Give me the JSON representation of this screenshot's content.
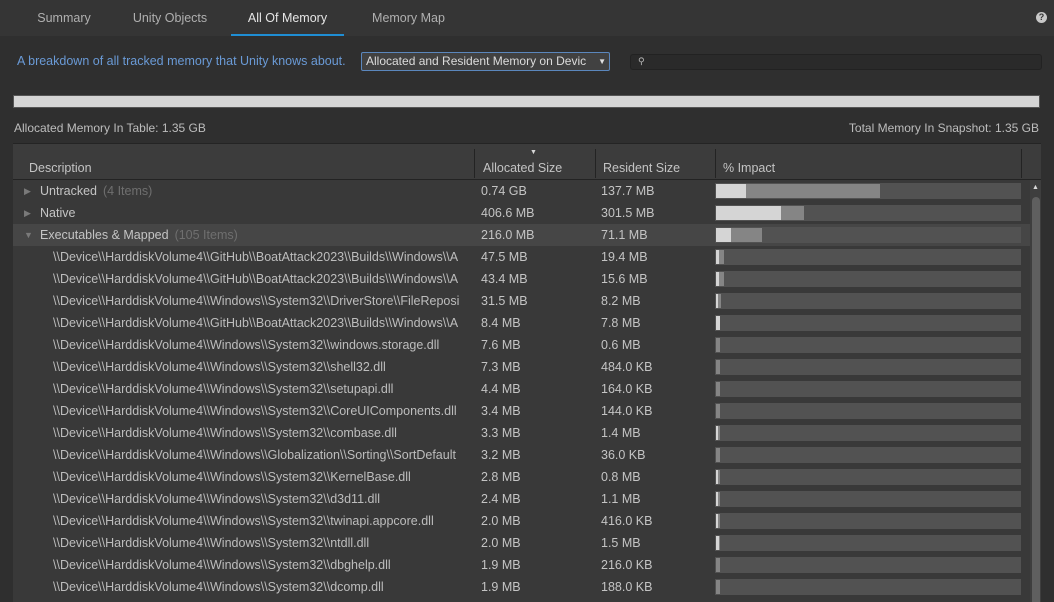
{
  "tabs": [
    {
      "label": "Summary",
      "active": false
    },
    {
      "label": "Unity Objects",
      "active": false
    },
    {
      "label": "All Of Memory",
      "active": true
    },
    {
      "label": "Memory Map",
      "active": false
    }
  ],
  "help_icon": "question-circle-icon",
  "description": "A breakdown of all tracked memory that Unity knows about.",
  "view_dropdown": {
    "selected": "Allocated and Resident Memory on Device",
    "display": "Allocated and Resident Memory on Devic"
  },
  "search": {
    "value": "",
    "placeholder": "",
    "icon": "search-icon"
  },
  "summary": {
    "overall_fraction": 1.0,
    "allocated_label": "Allocated Memory In Table: 1.35 GB",
    "total_label": "Total Memory In Snapshot: 1.35 GB"
  },
  "columns": [
    "Description",
    "Allocated Size",
    "Resident Size",
    "% Impact"
  ],
  "sort": {
    "column": "Allocated Size",
    "direction": "descending"
  },
  "rows": [
    {
      "name": "Untracked",
      "count": "(4 Items)",
      "expanded": false,
      "level": 0,
      "allocated": "0.74 GB",
      "resident": "137.7 MB",
      "impact_alloc": 0.54,
      "impact_res": 0.1
    },
    {
      "name": "Native",
      "count": "",
      "expanded": false,
      "level": 0,
      "allocated": "406.6 MB",
      "resident": "301.5 MB",
      "impact_alloc": 0.29,
      "impact_res": 0.215
    },
    {
      "name": "Executables & Mapped",
      "count": "(105 Items)",
      "expanded": true,
      "level": 0,
      "selected": true,
      "allocated": "216.0 MB",
      "resident": "71.1 MB",
      "impact_alloc": 0.152,
      "impact_res": 0.05
    },
    {
      "name": "\\\\Device\\\\HarddiskVolume4\\\\GitHub\\\\BoatAttack2023\\\\Builds\\\\Windows\\\\A",
      "level": 1,
      "allocated": "47.5 MB",
      "resident": "19.4 MB",
      "impact_alloc": 0.027,
      "impact_res": 0.011
    },
    {
      "name": "\\\\Device\\\\HarddiskVolume4\\\\GitHub\\\\BoatAttack2023\\\\Builds\\\\Windows\\\\A",
      "level": 1,
      "allocated": "43.4 MB",
      "resident": "15.6 MB",
      "impact_alloc": 0.027,
      "impact_res": 0.009
    },
    {
      "name": "\\\\Device\\\\HarddiskVolume4\\\\Windows\\\\System32\\\\DriverStore\\\\FileReposi",
      "level": 1,
      "allocated": "31.5 MB",
      "resident": "8.2 MB",
      "impact_alloc": 0.017,
      "impact_res": 0.004
    },
    {
      "name": "\\\\Device\\\\HarddiskVolume4\\\\GitHub\\\\BoatAttack2023\\\\Builds\\\\Windows\\\\A",
      "level": 1,
      "allocated": "8.4 MB",
      "resident": "7.8 MB",
      "impact_alloc": 0.013,
      "impact_res": 0.012
    },
    {
      "name": "\\\\Device\\\\HarddiskVolume4\\\\Windows\\\\System32\\\\windows.storage.dll",
      "level": 1,
      "allocated": "7.6 MB",
      "resident": "0.6 MB",
      "impact_alloc": 0.012,
      "impact_res": 0.0
    },
    {
      "name": "\\\\Device\\\\HarddiskVolume4\\\\Windows\\\\System32\\\\shell32.dll",
      "level": 1,
      "allocated": "7.3 MB",
      "resident": "484.0 KB",
      "impact_alloc": 0.012,
      "impact_res": 0.0
    },
    {
      "name": "\\\\Device\\\\HarddiskVolume4\\\\Windows\\\\System32\\\\setupapi.dll",
      "level": 1,
      "allocated": "4.4 MB",
      "resident": "164.0 KB",
      "impact_alloc": 0.012,
      "impact_res": 0.0
    },
    {
      "name": "\\\\Device\\\\HarddiskVolume4\\\\Windows\\\\System32\\\\CoreUIComponents.dll",
      "level": 1,
      "allocated": "3.4 MB",
      "resident": "144.0 KB",
      "impact_alloc": 0.012,
      "impact_res": 0.0
    },
    {
      "name": "\\\\Device\\\\HarddiskVolume4\\\\Windows\\\\System32\\\\combase.dll",
      "level": 1,
      "allocated": "3.3 MB",
      "resident": "1.4 MB",
      "impact_alloc": 0.012,
      "impact_res": 0.005
    },
    {
      "name": "\\\\Device\\\\HarddiskVolume4\\\\Windows\\\\Globalization\\\\Sorting\\\\SortDefault",
      "level": 1,
      "allocated": "3.2 MB",
      "resident": "36.0 KB",
      "impact_alloc": 0.012,
      "impact_res": 0.0
    },
    {
      "name": "\\\\Device\\\\HarddiskVolume4\\\\Windows\\\\System32\\\\KernelBase.dll",
      "level": 1,
      "allocated": "2.8 MB",
      "resident": "0.8 MB",
      "impact_alloc": 0.012,
      "impact_res": 0.003
    },
    {
      "name": "\\\\Device\\\\HarddiskVolume4\\\\Windows\\\\System32\\\\d3d11.dll",
      "level": 1,
      "allocated": "2.4 MB",
      "resident": "1.1 MB",
      "impact_alloc": 0.012,
      "impact_res": 0.004
    },
    {
      "name": "\\\\Device\\\\HarddiskVolume4\\\\Windows\\\\System32\\\\twinapi.appcore.dll",
      "level": 1,
      "allocated": "2.0 MB",
      "resident": "416.0 KB",
      "impact_alloc": 0.012,
      "impact_res": 0.003
    },
    {
      "name": "\\\\Device\\\\HarddiskVolume4\\\\Windows\\\\System32\\\\ntdll.dll",
      "level": 1,
      "allocated": "2.0 MB",
      "resident": "1.5 MB",
      "impact_alloc": 0.012,
      "impact_res": 0.009
    },
    {
      "name": "\\\\Device\\\\HarddiskVolume4\\\\Windows\\\\System32\\\\dbghelp.dll",
      "level": 1,
      "allocated": "1.9 MB",
      "resident": "216.0 KB",
      "impact_alloc": 0.012,
      "impact_res": 0.0
    },
    {
      "name": "\\\\Device\\\\HarddiskVolume4\\\\Windows\\\\System32\\\\dcomp.dll",
      "level": 1,
      "allocated": "1.9 MB",
      "resident": "188.0 KB",
      "impact_alloc": 0.012,
      "impact_res": 0.0
    }
  ],
  "colors": {
    "accent": "#1f8ed4",
    "link_text": "#6a9ad6",
    "allocated_bar": "#858585",
    "resident_bar": "#d5d5d5",
    "bar_track": "#525252"
  }
}
